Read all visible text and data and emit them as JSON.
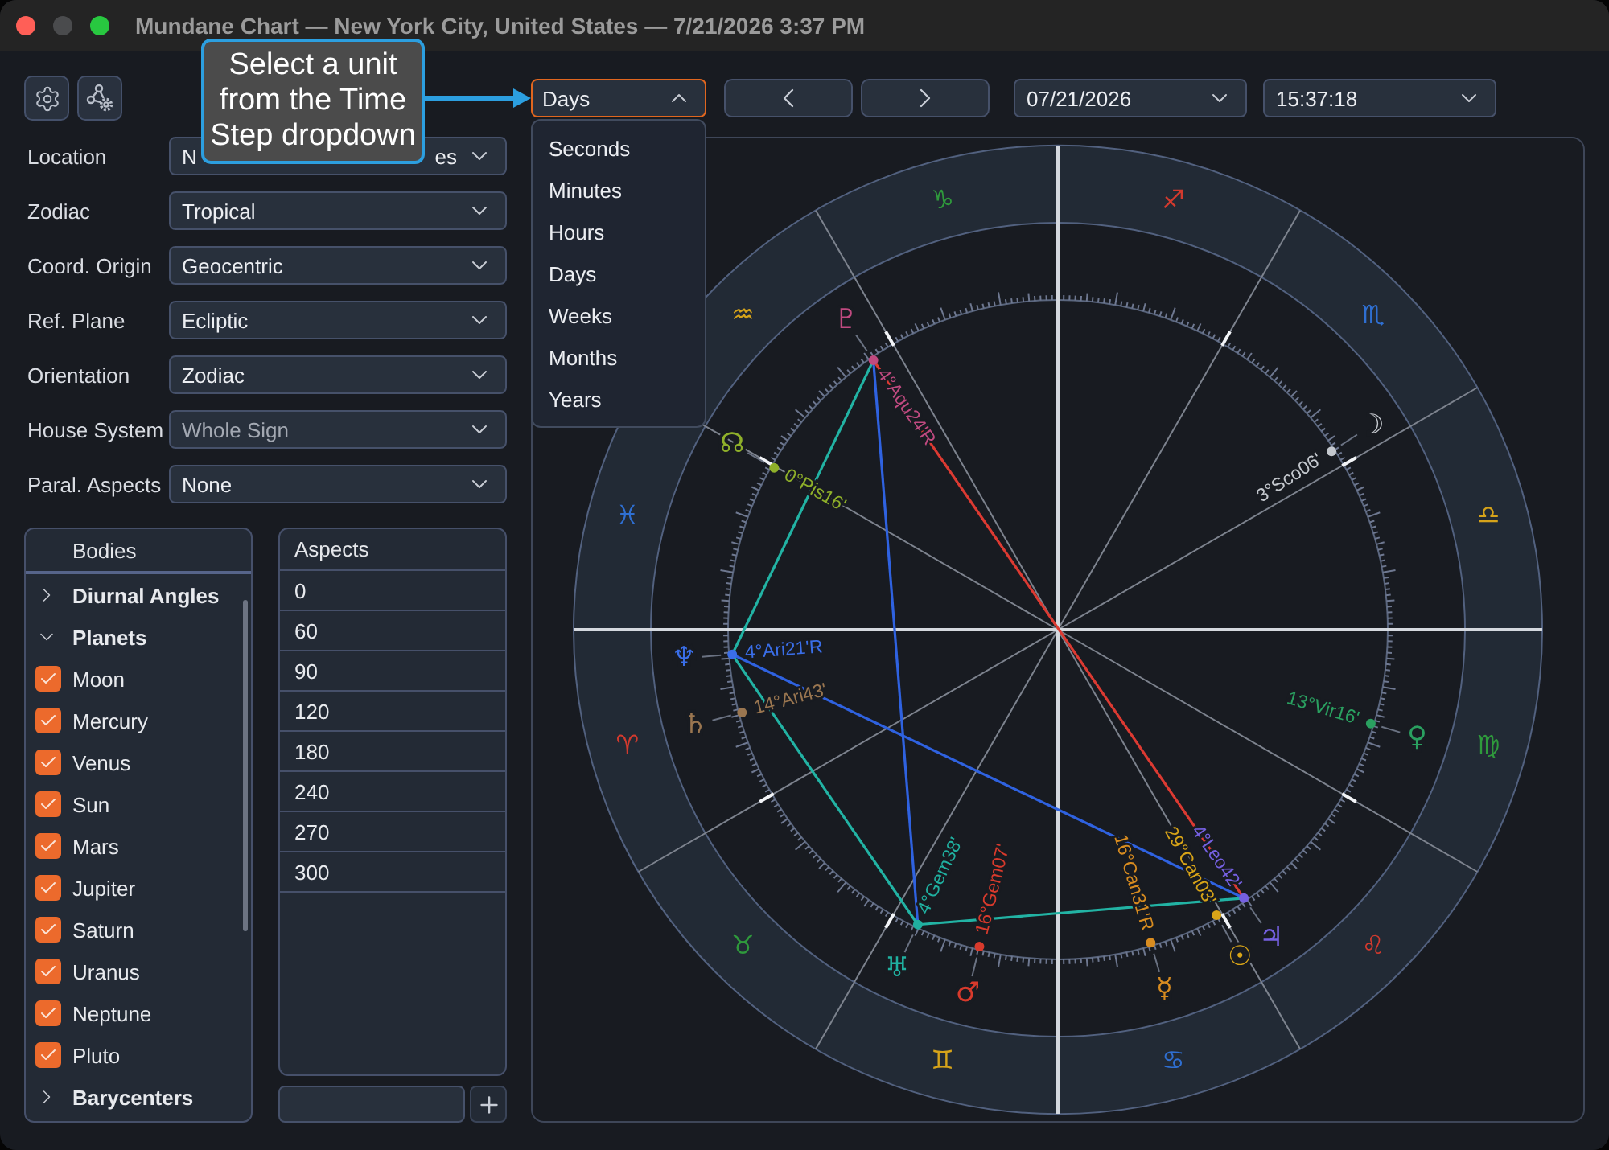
{
  "window": {
    "title": "Mundane Chart — New York City, United States — 7/21/2026 3:37 PM",
    "controls": [
      {
        "kind": "close",
        "disabled": false
      },
      {
        "kind": "minimize",
        "disabled": true
      },
      {
        "kind": "zoom",
        "disabled": false
      }
    ]
  },
  "callout": {
    "text": "Select a unit from the Time Step dropdown"
  },
  "fields": [
    {
      "label": "Location",
      "value": "N",
      "value_end": "es",
      "disabled": false
    },
    {
      "label": "Zodiac",
      "value": "Tropical",
      "disabled": false
    },
    {
      "label": "Coord. Origin",
      "value": "Geocentric",
      "disabled": false
    },
    {
      "label": "Ref. Plane",
      "value": "Ecliptic",
      "disabled": false
    },
    {
      "label": "Orientation",
      "value": "Zodiac",
      "disabled": false
    },
    {
      "label": "House System",
      "value": "Whole Sign",
      "disabled": true
    },
    {
      "label": "Paral. Aspects",
      "value": "None",
      "disabled": false
    }
  ],
  "bodies": {
    "title": "Bodies",
    "groups": [
      {
        "label": "Diurnal Angles",
        "expanded": false
      },
      {
        "label": "Planets",
        "expanded": true,
        "children": [
          {
            "label": "Moon",
            "checked": true
          },
          {
            "label": "Mercury",
            "checked": true
          },
          {
            "label": "Venus",
            "checked": true
          },
          {
            "label": "Sun",
            "checked": true
          },
          {
            "label": "Mars",
            "checked": true
          },
          {
            "label": "Jupiter",
            "checked": true
          },
          {
            "label": "Saturn",
            "checked": true
          },
          {
            "label": "Uranus",
            "checked": true
          },
          {
            "label": "Neptune",
            "checked": true
          },
          {
            "label": "Pluto",
            "checked": true
          }
        ]
      },
      {
        "label": "Barycenters",
        "expanded": false
      }
    ]
  },
  "aspects": {
    "title": "Aspects",
    "rows": [
      "0",
      "60",
      "90",
      "120",
      "180",
      "240",
      "270",
      "300"
    ]
  },
  "toolbar": {
    "time_step": {
      "value": "Days",
      "open": true,
      "options": [
        "Seconds",
        "Minutes",
        "Hours",
        "Days",
        "Weeks",
        "Months",
        "Years"
      ]
    },
    "date": "07/21/2026",
    "time": "15:37:18"
  },
  "chart": {
    "signs": [
      {
        "symbol": "♈",
        "color": "#d23a2e"
      },
      {
        "symbol": "♉",
        "color": "#2f9a3c"
      },
      {
        "symbol": "♊",
        "color": "#d6a31a"
      },
      {
        "symbol": "♋",
        "color": "#2f6fd2"
      },
      {
        "symbol": "♌",
        "color": "#d23a2e"
      },
      {
        "symbol": "♍",
        "color": "#2f9a3c"
      },
      {
        "symbol": "♎",
        "color": "#d6a31a"
      },
      {
        "symbol": "♏",
        "color": "#2f6fd2"
      },
      {
        "symbol": "♐",
        "color": "#d23a2e"
      },
      {
        "symbol": "♑",
        "color": "#2f9a3c"
      },
      {
        "symbol": "♒",
        "color": "#d6a31a"
      },
      {
        "symbol": "♓",
        "color": "#2f6fd2"
      }
    ],
    "planets": [
      {
        "kind": "moon",
        "symbol": "☽",
        "label": "3°Sco06'",
        "color": "#c4c8ce"
      },
      {
        "kind": "sun",
        "symbol": "☉",
        "label": "29°Can03'",
        "color": "#d8a418"
      },
      {
        "kind": "mercury",
        "symbol": "☿",
        "label": "16°Can31'R",
        "color": "#d88c20"
      },
      {
        "kind": "venus",
        "symbol": "♀",
        "label": "13°Vir16'",
        "color": "#2aa060"
      },
      {
        "kind": "mars",
        "symbol": "♂",
        "label": "16°Gem07'",
        "color": "#d83a2c"
      },
      {
        "kind": "jupiter",
        "symbol": "♃",
        "label": "4°Leo42'",
        "color": "#7560e0"
      },
      {
        "kind": "saturn",
        "symbol": "♄",
        "label": "14°Ari43'",
        "color": "#9a7650"
      },
      {
        "kind": "uranus",
        "symbol": "♅",
        "label": "4°Gem38'",
        "color": "#20b0a0"
      },
      {
        "kind": "neptune",
        "symbol": "♆",
        "label": "4°Ari21'R",
        "color": "#3a6ee8"
      },
      {
        "kind": "pluto",
        "symbol": "♇",
        "label": "4°Aqu24'R",
        "color": "#c04a80"
      },
      {
        "kind": "node",
        "symbol": "☊",
        "label": "0°Pis16'",
        "color": "#8fb02a"
      }
    ]
  }
}
